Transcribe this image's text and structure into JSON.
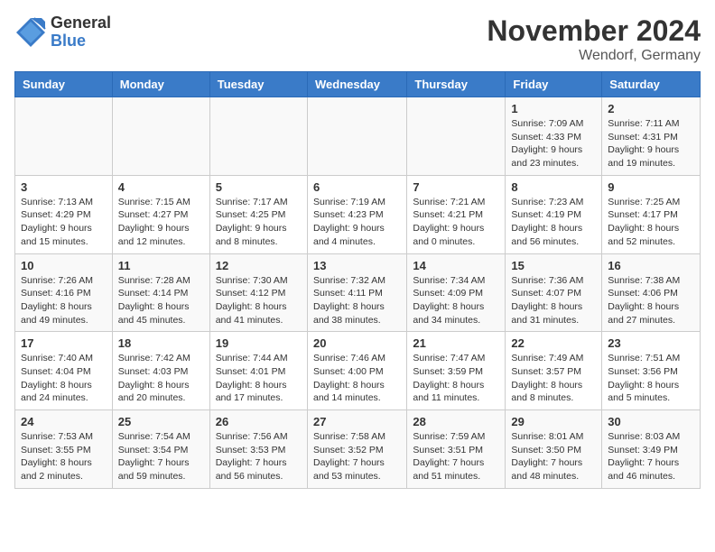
{
  "logo": {
    "general": "General",
    "blue": "Blue"
  },
  "title": "November 2024",
  "location": "Wendorf, Germany",
  "days_of_week": [
    "Sunday",
    "Monday",
    "Tuesday",
    "Wednesday",
    "Thursday",
    "Friday",
    "Saturday"
  ],
  "weeks": [
    [
      {
        "day": "",
        "info": ""
      },
      {
        "day": "",
        "info": ""
      },
      {
        "day": "",
        "info": ""
      },
      {
        "day": "",
        "info": ""
      },
      {
        "day": "",
        "info": ""
      },
      {
        "day": "1",
        "info": "Sunrise: 7:09 AM\nSunset: 4:33 PM\nDaylight: 9 hours\nand 23 minutes."
      },
      {
        "day": "2",
        "info": "Sunrise: 7:11 AM\nSunset: 4:31 PM\nDaylight: 9 hours\nand 19 minutes."
      }
    ],
    [
      {
        "day": "3",
        "info": "Sunrise: 7:13 AM\nSunset: 4:29 PM\nDaylight: 9 hours\nand 15 minutes."
      },
      {
        "day": "4",
        "info": "Sunrise: 7:15 AM\nSunset: 4:27 PM\nDaylight: 9 hours\nand 12 minutes."
      },
      {
        "day": "5",
        "info": "Sunrise: 7:17 AM\nSunset: 4:25 PM\nDaylight: 9 hours\nand 8 minutes."
      },
      {
        "day": "6",
        "info": "Sunrise: 7:19 AM\nSunset: 4:23 PM\nDaylight: 9 hours\nand 4 minutes."
      },
      {
        "day": "7",
        "info": "Sunrise: 7:21 AM\nSunset: 4:21 PM\nDaylight: 9 hours\nand 0 minutes."
      },
      {
        "day": "8",
        "info": "Sunrise: 7:23 AM\nSunset: 4:19 PM\nDaylight: 8 hours\nand 56 minutes."
      },
      {
        "day": "9",
        "info": "Sunrise: 7:25 AM\nSunset: 4:17 PM\nDaylight: 8 hours\nand 52 minutes."
      }
    ],
    [
      {
        "day": "10",
        "info": "Sunrise: 7:26 AM\nSunset: 4:16 PM\nDaylight: 8 hours\nand 49 minutes."
      },
      {
        "day": "11",
        "info": "Sunrise: 7:28 AM\nSunset: 4:14 PM\nDaylight: 8 hours\nand 45 minutes."
      },
      {
        "day": "12",
        "info": "Sunrise: 7:30 AM\nSunset: 4:12 PM\nDaylight: 8 hours\nand 41 minutes."
      },
      {
        "day": "13",
        "info": "Sunrise: 7:32 AM\nSunset: 4:11 PM\nDaylight: 8 hours\nand 38 minutes."
      },
      {
        "day": "14",
        "info": "Sunrise: 7:34 AM\nSunset: 4:09 PM\nDaylight: 8 hours\nand 34 minutes."
      },
      {
        "day": "15",
        "info": "Sunrise: 7:36 AM\nSunset: 4:07 PM\nDaylight: 8 hours\nand 31 minutes."
      },
      {
        "day": "16",
        "info": "Sunrise: 7:38 AM\nSunset: 4:06 PM\nDaylight: 8 hours\nand 27 minutes."
      }
    ],
    [
      {
        "day": "17",
        "info": "Sunrise: 7:40 AM\nSunset: 4:04 PM\nDaylight: 8 hours\nand 24 minutes."
      },
      {
        "day": "18",
        "info": "Sunrise: 7:42 AM\nSunset: 4:03 PM\nDaylight: 8 hours\nand 20 minutes."
      },
      {
        "day": "19",
        "info": "Sunrise: 7:44 AM\nSunset: 4:01 PM\nDaylight: 8 hours\nand 17 minutes."
      },
      {
        "day": "20",
        "info": "Sunrise: 7:46 AM\nSunset: 4:00 PM\nDaylight: 8 hours\nand 14 minutes."
      },
      {
        "day": "21",
        "info": "Sunrise: 7:47 AM\nSunset: 3:59 PM\nDaylight: 8 hours\nand 11 minutes."
      },
      {
        "day": "22",
        "info": "Sunrise: 7:49 AM\nSunset: 3:57 PM\nDaylight: 8 hours\nand 8 minutes."
      },
      {
        "day": "23",
        "info": "Sunrise: 7:51 AM\nSunset: 3:56 PM\nDaylight: 8 hours\nand 5 minutes."
      }
    ],
    [
      {
        "day": "24",
        "info": "Sunrise: 7:53 AM\nSunset: 3:55 PM\nDaylight: 8 hours\nand 2 minutes."
      },
      {
        "day": "25",
        "info": "Sunrise: 7:54 AM\nSunset: 3:54 PM\nDaylight: 7 hours\nand 59 minutes."
      },
      {
        "day": "26",
        "info": "Sunrise: 7:56 AM\nSunset: 3:53 PM\nDaylight: 7 hours\nand 56 minutes."
      },
      {
        "day": "27",
        "info": "Sunrise: 7:58 AM\nSunset: 3:52 PM\nDaylight: 7 hours\nand 53 minutes."
      },
      {
        "day": "28",
        "info": "Sunrise: 7:59 AM\nSunset: 3:51 PM\nDaylight: 7 hours\nand 51 minutes."
      },
      {
        "day": "29",
        "info": "Sunrise: 8:01 AM\nSunset: 3:50 PM\nDaylight: 7 hours\nand 48 minutes."
      },
      {
        "day": "30",
        "info": "Sunrise: 8:03 AM\nSunset: 3:49 PM\nDaylight: 7 hours\nand 46 minutes."
      }
    ]
  ]
}
